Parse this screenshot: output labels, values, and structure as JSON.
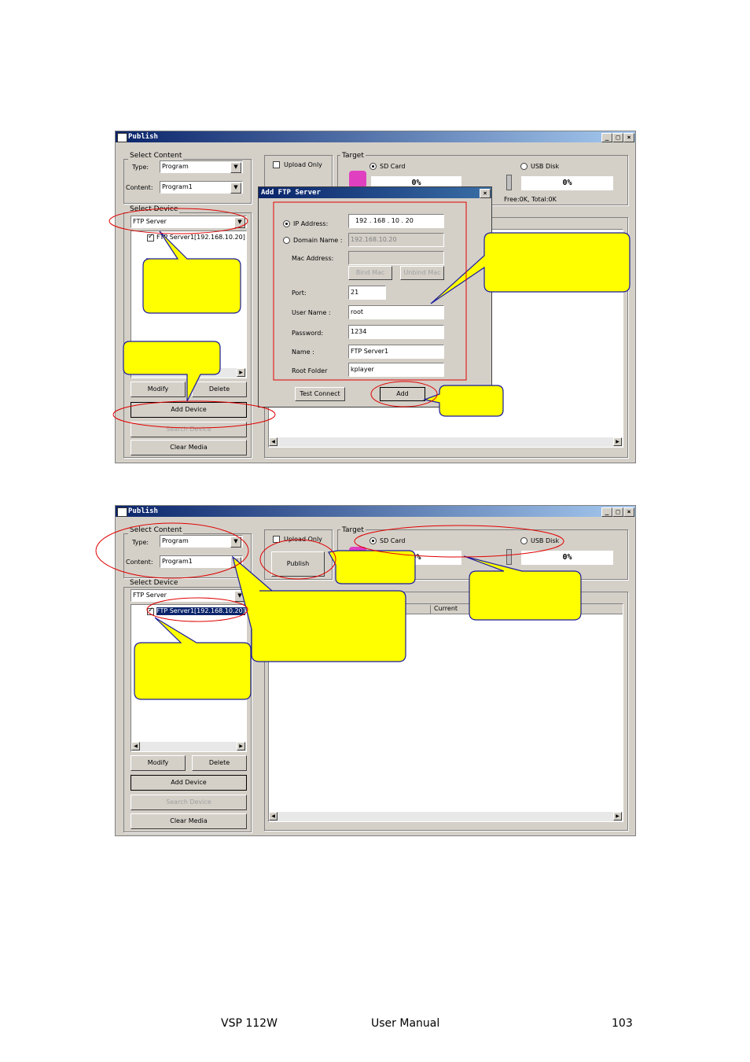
{
  "window": {
    "title": "Publish",
    "select_content": "Select Content",
    "type_label": "Type:",
    "type_value": "Program",
    "content_label": "Content:",
    "content_value": "Program1",
    "select_device": "Select Device",
    "device_type": "FTP Server",
    "device_item": "FTP Server1[192.168.10.20]",
    "upload_only": "Upload Only",
    "publish": "Publish",
    "target": "Target",
    "sd_card": "SD Card",
    "usb_disk": "USB Disk",
    "sd_pct": "0%",
    "usb_pct": "0%",
    "free_total": "Free:0K, Total:0K",
    "current_col": "Current",
    "modify": "Modify",
    "delete": "Delete",
    "add_device": "Add Device",
    "search_device": "Search Device",
    "clear_media": "Clear Media"
  },
  "dialog": {
    "title": "Add FTP Server",
    "ip_label": "IP Address:",
    "ip_value": "192 . 168 . 10 . 20",
    "domain_label": "Domain Name :",
    "domain_value": "192.168.10.20",
    "mac_label": "Mac Address:",
    "bind_mac": "Bind Mac",
    "unbind_mac": "Unbind Mac",
    "port_label": "Port:",
    "port_value": "21",
    "user_label": "User Name :",
    "user_value": "root",
    "password_label": "Password:",
    "password_value": "1234",
    "name_label": "Name :",
    "name_value": "FTP Server1",
    "root_label": "Root Folder",
    "root_value": "kplayer",
    "test_connect": "Test Connect",
    "add": "Add"
  },
  "footer": {
    "product": "VSP 112W",
    "manual": "User Manual",
    "page": "103"
  },
  "colors": {
    "callout_fill": "#ffff00",
    "callout_stroke": "#1a1aa0",
    "highlight_red": "#e00000",
    "title_blue": "#0a246a"
  }
}
